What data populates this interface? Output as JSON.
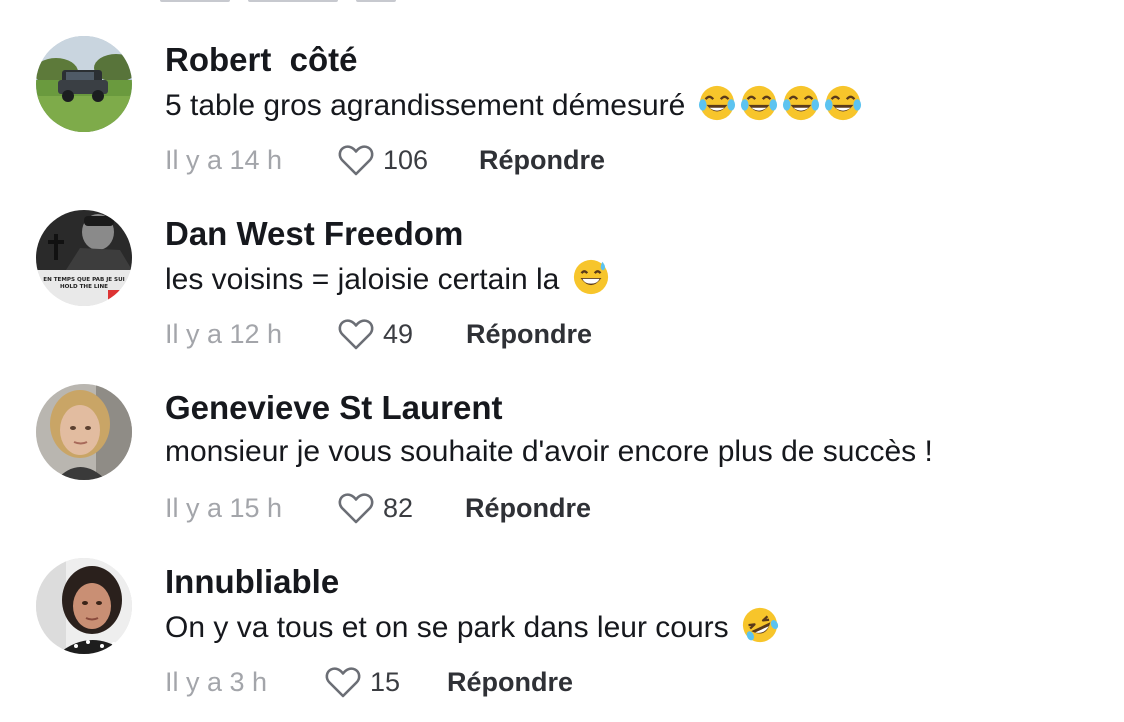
{
  "comments": [
    {
      "username": "Robert  côté",
      "text": "5 table gros agrandissement démesuré",
      "emoji": [
        "face-with-tears-of-joy",
        "face-with-tears-of-joy",
        "face-with-tears-of-joy",
        "face-with-tears-of-joy"
      ],
      "timestamp": "Il y a 14 h",
      "likes": "106",
      "reply_label": "Répondre",
      "avatar": "pickup-truck-in-field-photo"
    },
    {
      "username": "Dan West Freedom",
      "text": "les voisins = jaloisie certain la",
      "emoji": [
        "grinning-face-with-sweat"
      ],
      "timestamp": "Il y a 12 h",
      "likes": "49",
      "reply_label": "Répondre",
      "avatar": "black-and-white-portrait-photo",
      "avatar_caption": "EN TEMPS QUE PAB JE SUI\nHOLD THE LINE"
    },
    {
      "username": "Genevieve St Laurent",
      "text": "monsieur je vous souhaite d'avoir encore plus de succès !",
      "emoji": [],
      "timestamp": "Il y a 15 h",
      "likes": "82",
      "reply_label": "Répondre",
      "avatar": "woman-portrait-photo"
    },
    {
      "username": "Innubliable",
      "text": "On y va tous et on se park dans leur cours",
      "emoji": [
        "rolling-on-the-floor-laughing"
      ],
      "timestamp": "Il y a 3 h",
      "likes": "15",
      "reply_label": "Répondre",
      "avatar": "woman-selfie-photo"
    }
  ],
  "colors": {
    "text": "#16181d",
    "muted": "#a3a5aa",
    "emoji_yellow": "#f7c52b"
  }
}
